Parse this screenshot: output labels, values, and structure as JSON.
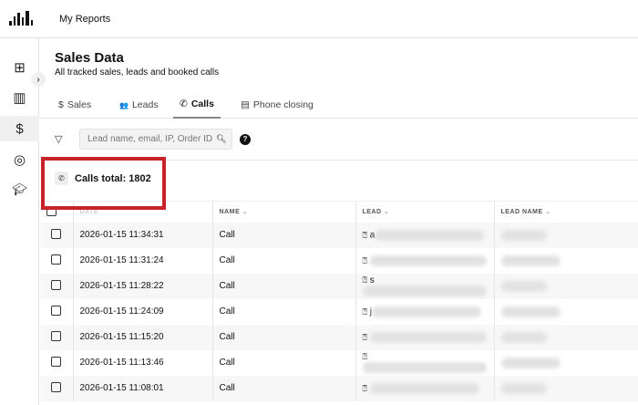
{
  "app": {
    "title": "My Reports"
  },
  "page": {
    "title": "Sales Data",
    "subtitle": "All tracked sales, leads and booked calls"
  },
  "tabs": [
    {
      "label": "Sales",
      "icon": "$"
    },
    {
      "label": "Leads",
      "icon": "👥"
    },
    {
      "label": "Calls",
      "icon": "✆"
    },
    {
      "label": "Phone closing",
      "icon": "▤"
    }
  ],
  "search": {
    "placeholder": "Lead name, email, IP, Order ID"
  },
  "summary": {
    "label": "Calls total: 1802"
  },
  "table": {
    "headers": [
      "DATE",
      "NAME",
      "LEAD",
      "LEAD NAME"
    ],
    "rows": [
      {
        "date": "2026-01-15 11:34:31",
        "name": "Call",
        "lead": "a"
      },
      {
        "date": "2026-01-15 11:31:24",
        "name": "Call",
        "lead": ""
      },
      {
        "date": "2026-01-15 11:28:22",
        "name": "Call",
        "lead": "s"
      },
      {
        "date": "2026-01-15 11:24:09",
        "name": "Call",
        "lead": "j"
      },
      {
        "date": "2026-01-15 11:15:20",
        "name": "Call",
        "lead": ""
      },
      {
        "date": "2026-01-15 11:13:46",
        "name": "Call",
        "lead": ""
      },
      {
        "date": "2026-01-15 11:08:01",
        "name": "Call",
        "lead": ""
      }
    ]
  },
  "colors": {
    "highlight": "#c8232a"
  }
}
